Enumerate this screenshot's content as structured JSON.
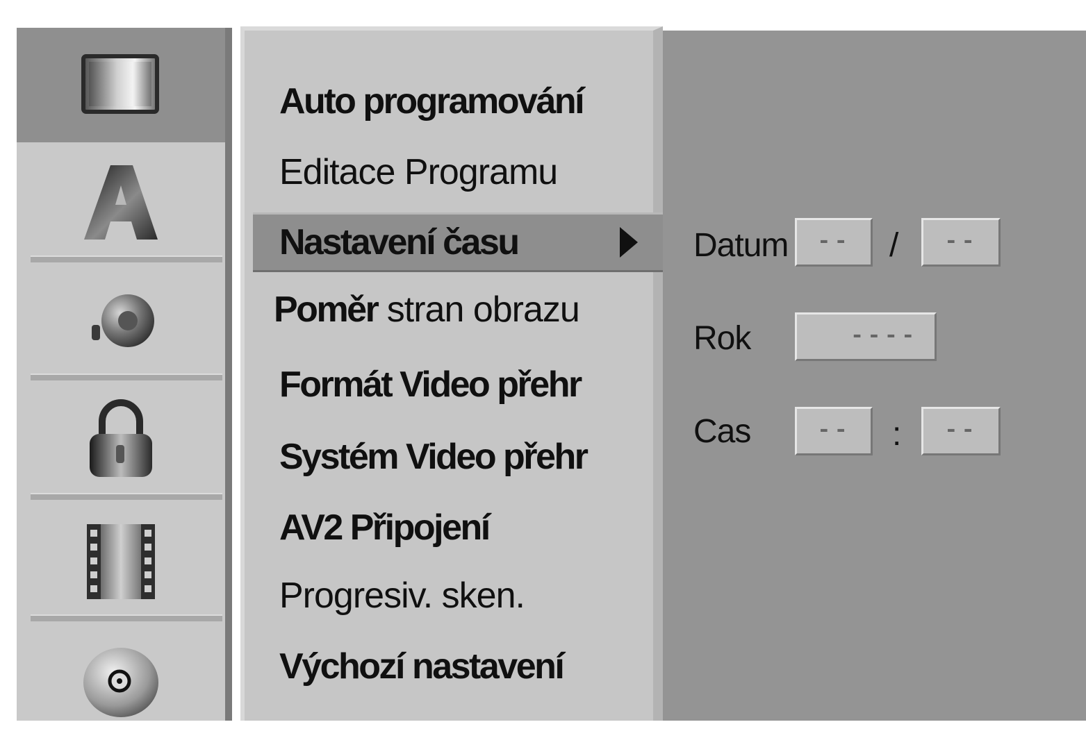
{
  "menu": {
    "items": [
      {
        "label": "Auto programování"
      },
      {
        "label": "Editace Programu"
      },
      {
        "label": "Nastavení času"
      },
      {
        "label_bold": "Poměr",
        "label_rest": " stran obrazu"
      },
      {
        "label": "Formát Video přehr"
      },
      {
        "label": "Systém Video přehr"
      },
      {
        "label": "AV2 Připojení"
      },
      {
        "label": "Progresiv. sken."
      },
      {
        "label": "Výchozí nastavení"
      }
    ]
  },
  "settings": {
    "datum_label": "Datum",
    "datum_separator": "/",
    "datum_day": "--",
    "datum_month": "--",
    "rok_label": "Rok",
    "rok_value": "----",
    "cas_label": "Cas",
    "cas_separator": ":",
    "cas_hour": "--",
    "cas_minute": "--"
  },
  "icons": [
    "screen-icon",
    "language-icon",
    "audio-icon",
    "lock-icon",
    "film-icon",
    "disc-icon"
  ]
}
